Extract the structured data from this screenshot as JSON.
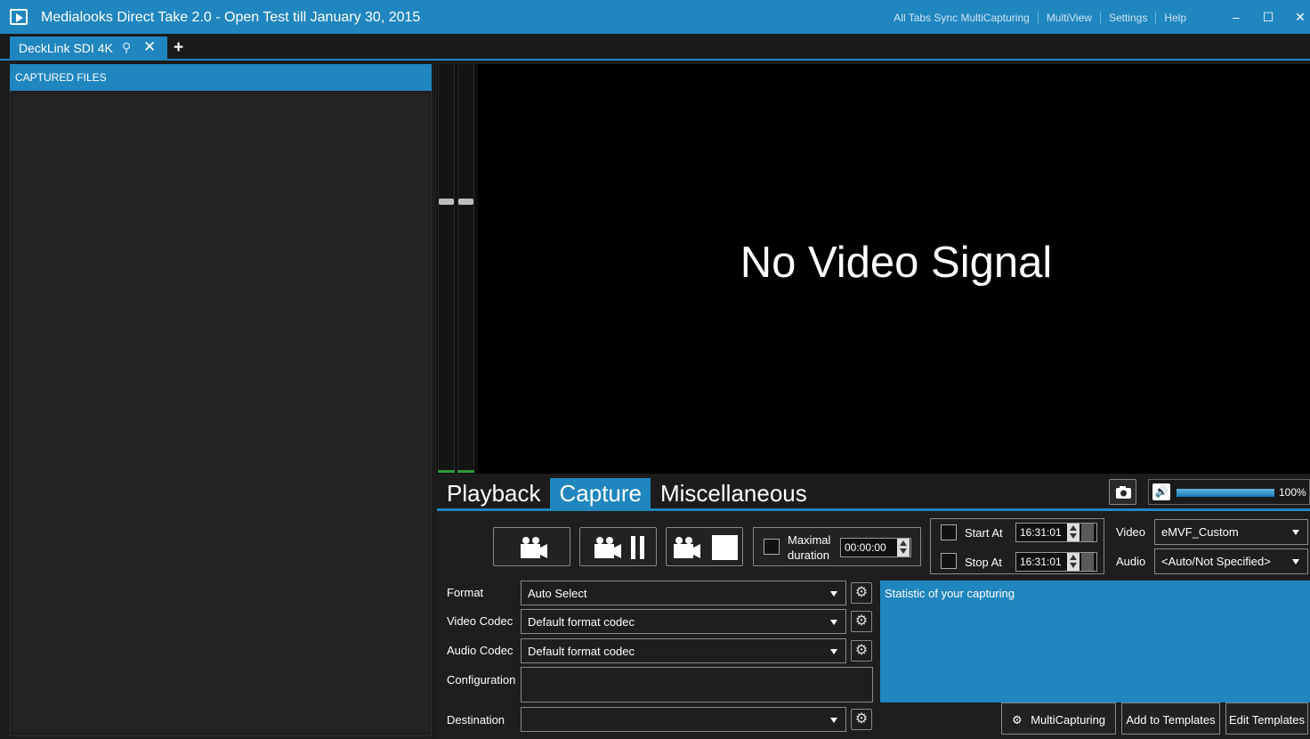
{
  "window": {
    "title": "Medialooks Direct Take 2.0 - Open Test till January 30, 2015",
    "menu": [
      "All Tabs Sync MultiCapturing",
      "MultiView",
      "Settings",
      "Help"
    ],
    "minimize": "‒",
    "maximize": "☐",
    "close": "✕"
  },
  "tabs": {
    "device_tab": "DeckLink SDI 4K",
    "pin_icon": "⚲",
    "close_icon": "✕",
    "add_icon": "+"
  },
  "files_panel": {
    "title": "CAPTURED FILES"
  },
  "video": {
    "message": "No Video Signal"
  },
  "mode_tabs": [
    "Playback",
    "Capture",
    "Miscellaneous"
  ],
  "volume": {
    "icon": "🔊",
    "level_percent": 100,
    "label": "100%"
  },
  "capture": {
    "max_duration_label_1": "Maximal",
    "max_duration_label_2": "duration",
    "max_duration_value": "00:00:00",
    "start_at_label": "Start At",
    "start_at_value": "16:31:01",
    "stop_at_label": "Stop At",
    "stop_at_value": "16:31:01",
    "video_label": "Video",
    "video_value": "eMVF_Custom",
    "audio_label": "Audio",
    "audio_value": "<Auto/Not Specified>"
  },
  "settings": {
    "format_label": "Format",
    "format_value": "Auto Select",
    "video_codec_label": "Video Codec",
    "video_codec_value": "Default format codec",
    "audio_codec_label": "Audio Codec",
    "audio_codec_value": "Default format codec",
    "configuration_label": "Configuration",
    "destination_label": "Destination",
    "gear_icon": "⚙"
  },
  "stats": {
    "text": "Statistic of your capturing"
  },
  "actions": {
    "multicapturing": "MultiCapturing",
    "add_to_templates": "Add to Templates",
    "edit_templates": "Edit Templates"
  },
  "colors": {
    "accent": "#1f86bf",
    "background": "#1c1c1c"
  }
}
